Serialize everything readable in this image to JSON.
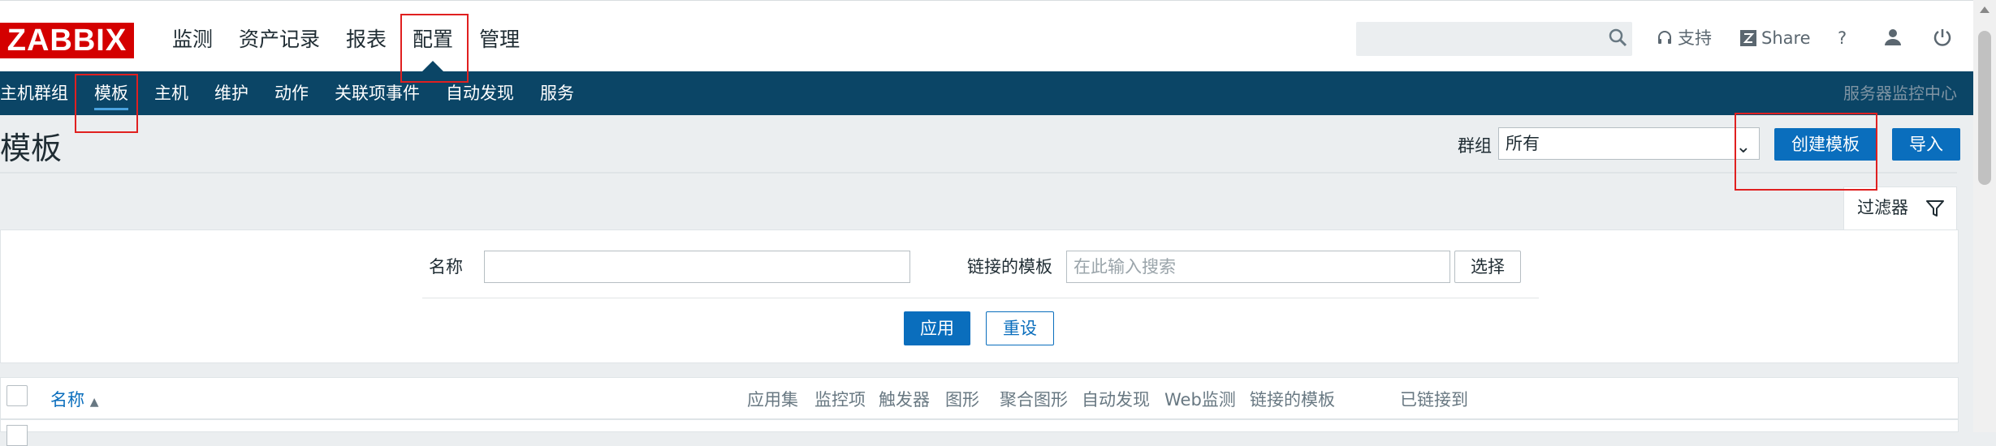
{
  "brand": {
    "logo_text": "ZABBIX",
    "color": "#d40000"
  },
  "top_menu": [
    {
      "label": "监测"
    },
    {
      "label": "资产记录"
    },
    {
      "label": "报表"
    },
    {
      "label": "配置",
      "active": true
    },
    {
      "label": "管理"
    }
  ],
  "top_tools": {
    "search_placeholder": "",
    "search_icon": "search-icon",
    "support_label": "支持",
    "share_label": "Share",
    "help_label": "?",
    "profile_icon": "user-icon",
    "logout_icon": "power-icon"
  },
  "sub_menu": [
    {
      "label": "主机群组"
    },
    {
      "label": "模板",
      "active": true
    },
    {
      "label": "主机"
    },
    {
      "label": "维护"
    },
    {
      "label": "动作"
    },
    {
      "label": "关联项事件"
    },
    {
      "label": "自动发现"
    },
    {
      "label": "服务"
    }
  ],
  "sub_right": "服务器监控中心",
  "page": {
    "title": "模板",
    "group_label": "群组",
    "group_value": "所有",
    "create_button": "创建模板",
    "import_button": "导入"
  },
  "filter": {
    "tab_label": "过滤器",
    "name_label": "名称",
    "name_value": "",
    "linked_label": "链接的模板",
    "linked_placeholder": "在此输入搜索",
    "select_button": "选择",
    "apply_button": "应用",
    "reset_button": "重设"
  },
  "table": {
    "columns": [
      "名称",
      "应用集",
      "监控项",
      "触发器",
      "图形",
      "聚合图形",
      "自动发现",
      "Web监测",
      "链接的模板",
      "已链接到"
    ]
  },
  "colors": {
    "accent": "#0a6ebd",
    "nav_bg": "#0b4566",
    "highlight": "#e02020"
  }
}
